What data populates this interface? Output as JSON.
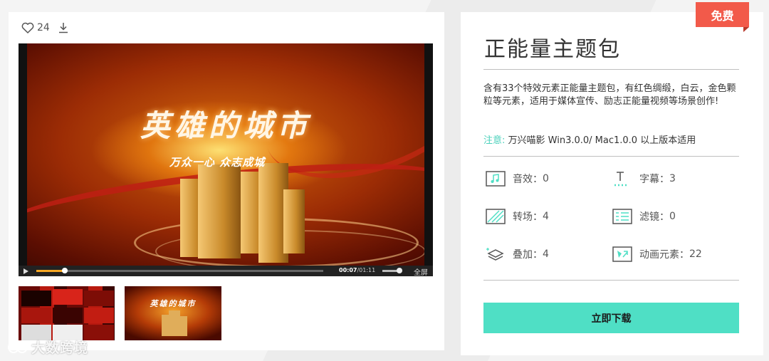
{
  "toolbar": {
    "like_count": "24"
  },
  "player": {
    "video_title": "英雄的城市",
    "video_subtitle": "万众一心 众志成城",
    "current_time": "00:07",
    "duration": "/01:11",
    "progress": 0.1,
    "fullscreen_label": "全屏"
  },
  "thumbnails": {
    "thumb2_title": "英雄的城市"
  },
  "watermark": "大数跨境",
  "product": {
    "badge": "免费",
    "title": "正能量主题包",
    "description": "含有33个特效元素正能量主题包，有红色绸缎，白云，金色颗粒等元素，适用于媒体宣传、励志正能量视频等场景创作!",
    "note_label": "注意:",
    "note_text": " 万兴喵影 Win3.0.0/ Mac1.0.0 以上版本适用",
    "features": [
      {
        "icon": "music-icon",
        "label": "音效：",
        "value": "0"
      },
      {
        "icon": "text-icon",
        "label": "字幕：",
        "value": "3"
      },
      {
        "icon": "transition-icon",
        "label": "转场：",
        "value": "4"
      },
      {
        "icon": "filter-icon",
        "label": "滤镜：",
        "value": "0"
      },
      {
        "icon": "overlay-icon",
        "label": "叠加：",
        "value": "4"
      },
      {
        "icon": "animation-icon",
        "label": "动画元素：",
        "value": "22"
      }
    ],
    "download_label": "立即下载"
  },
  "colors": {
    "accent": "#4fdfc5",
    "badge": "#f25a4a",
    "progress": "#f5a623"
  }
}
